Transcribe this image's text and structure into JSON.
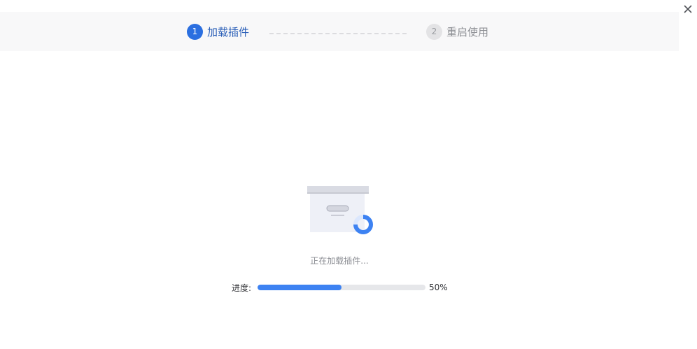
{
  "window": {
    "close_icon": "close-icon"
  },
  "steps": [
    {
      "number": "1",
      "label": "加载插件",
      "state": "active"
    },
    {
      "number": "2",
      "label": "重启使用",
      "state": "pending"
    }
  ],
  "status": {
    "message": "正在加载插件...",
    "illustration_icon": "archive-box-loading-icon"
  },
  "progress": {
    "label": "进度:",
    "value_text": "50%",
    "fraction": 0.5
  },
  "colors": {
    "accent": "#2b6fe0",
    "progress_fill": "#3d82f2",
    "progress_track": "#e6e7ea",
    "inactive_step": "#e3e3e5"
  }
}
